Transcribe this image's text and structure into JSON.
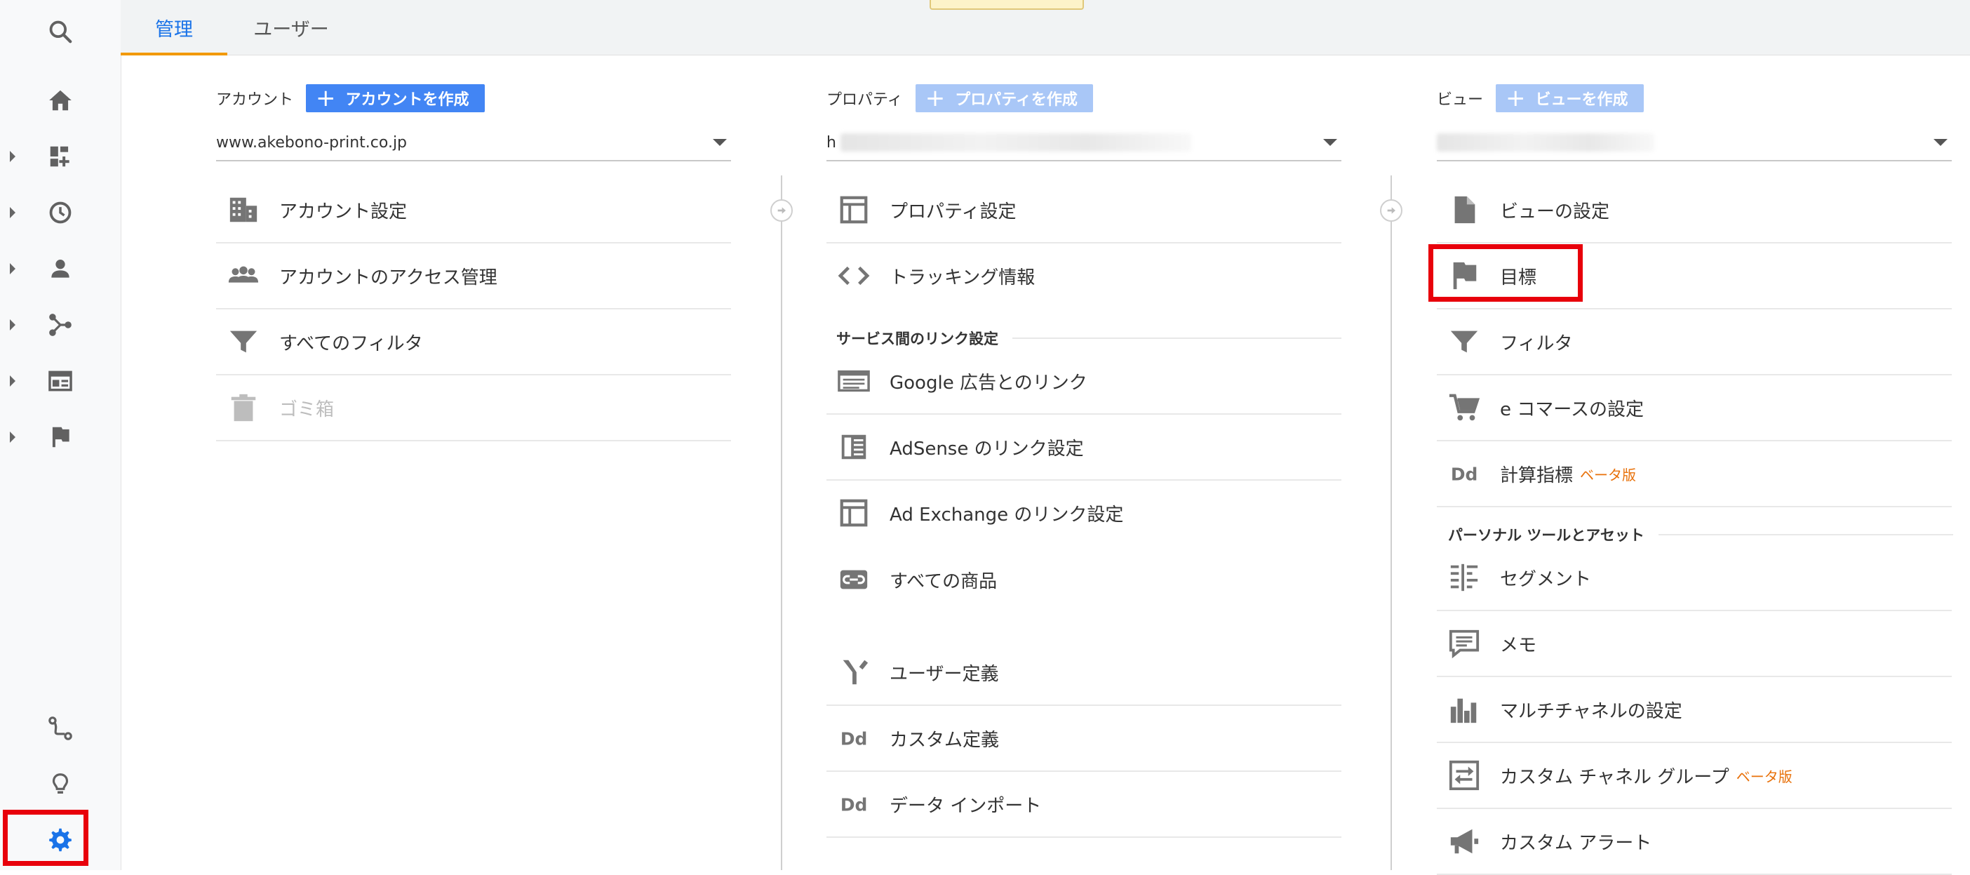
{
  "tabs": [
    {
      "label": "管理",
      "active": true
    },
    {
      "label": "ユーザー",
      "active": false
    }
  ],
  "account": {
    "label": "アカウント",
    "create_label": "アカウントを作成",
    "selected": "www.akebono-print.co.jp",
    "items": [
      {
        "label": "アカウント設定",
        "icon": "building-icon"
      },
      {
        "label": "アカウントのアクセス管理",
        "icon": "people-icon"
      },
      {
        "label": "すべてのフィルタ",
        "icon": "filter-icon"
      },
      {
        "label": "ゴミ箱",
        "icon": "trash-icon",
        "disabled": true
      }
    ]
  },
  "property": {
    "label": "プロパティ",
    "create_label": "プロパティを作成",
    "selected_prefix": "h",
    "items": [
      {
        "label": "プロパティ設定",
        "icon": "property-window-icon"
      },
      {
        "label": "トラッキング情報",
        "icon": "code-icon"
      }
    ],
    "section_label": "サービス間のリンク設定",
    "link_items": [
      {
        "label": "Google 広告とのリンク",
        "icon": "ads-icon"
      },
      {
        "label": "AdSense のリンク設定",
        "icon": "adsense-icon"
      },
      {
        "label": "Ad Exchange のリンク設定",
        "icon": "adexchange-icon"
      },
      {
        "label": "すべての商品",
        "icon": "link-icon"
      }
    ],
    "more_items": [
      {
        "label": "ユーザー定義",
        "icon": "fork-icon"
      },
      {
        "label": "カスタム定義",
        "icon": "dd-icon"
      },
      {
        "label": "データ インポート",
        "icon": "dd-icon"
      }
    ]
  },
  "view": {
    "label": "ビュー",
    "create_label": "ビューを作成",
    "items": [
      {
        "label": "ビューの設定",
        "icon": "document-icon"
      },
      {
        "label": "目標",
        "icon": "flag-icon"
      },
      {
        "label": "フィルタ",
        "icon": "filter-icon"
      },
      {
        "label": "e コマースの設定",
        "icon": "cart-icon"
      },
      {
        "label": "計算指標",
        "icon": "dd-icon",
        "badge": "ベータ版"
      }
    ],
    "section_label": "パーソナル ツールとアセット",
    "tool_items": [
      {
        "label": "セグメント",
        "icon": "segment-icon"
      },
      {
        "label": "メモ",
        "icon": "comment-icon"
      },
      {
        "label": "マルチチャネルの設定",
        "icon": "bar-chart-icon"
      },
      {
        "label": "カスタム チャネル グループ",
        "icon": "channel-group-icon",
        "badge": "ベータ版"
      },
      {
        "label": "カスタム アラート",
        "icon": "megaphone-icon"
      }
    ]
  },
  "colors": {
    "accent": "#1a73e8",
    "tab_underline": "#f29900",
    "button": "#4285f4",
    "highlight": "#e8000b",
    "beta": "#e8710a"
  }
}
